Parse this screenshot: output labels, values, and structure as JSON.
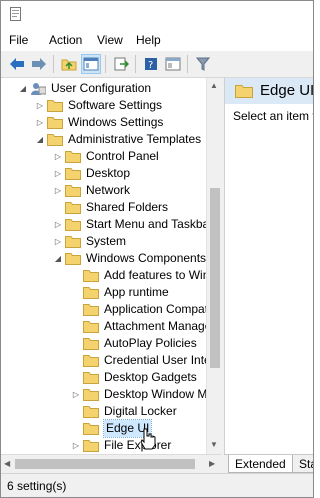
{
  "menu": [
    "File",
    "Action",
    "View",
    "Help"
  ],
  "tree": {
    "root": "User Configuration",
    "items": [
      {
        "label": "Software Settings"
      },
      {
        "label": "Windows Settings"
      },
      {
        "label": "Administrative Templates"
      },
      {
        "label": "Control Panel"
      },
      {
        "label": "Desktop"
      },
      {
        "label": "Network"
      },
      {
        "label": "Shared Folders"
      },
      {
        "label": "Start Menu and Taskbar"
      },
      {
        "label": "System"
      },
      {
        "label": "Windows Components"
      },
      {
        "label": "Add features to Winc"
      },
      {
        "label": "App runtime"
      },
      {
        "label": "Application Compati"
      },
      {
        "label": "Attachment Manage"
      },
      {
        "label": "AutoPlay Policies"
      },
      {
        "label": "Credential User Interf"
      },
      {
        "label": "Desktop Gadgets"
      },
      {
        "label": "Desktop Window Ma"
      },
      {
        "label": "Digital Locker"
      },
      {
        "label": "Edge UI"
      },
      {
        "label": "File Explorer"
      }
    ]
  },
  "right_pane": {
    "title": "Edge UI",
    "text": "Select an item to"
  },
  "tabs": {
    "extended": "Extended",
    "standard": "Star"
  },
  "status": "6 setting(s)",
  "colors": {
    "folder": "#f4d36f",
    "selection": "#cde8ff",
    "header": "#dbe9f7"
  }
}
